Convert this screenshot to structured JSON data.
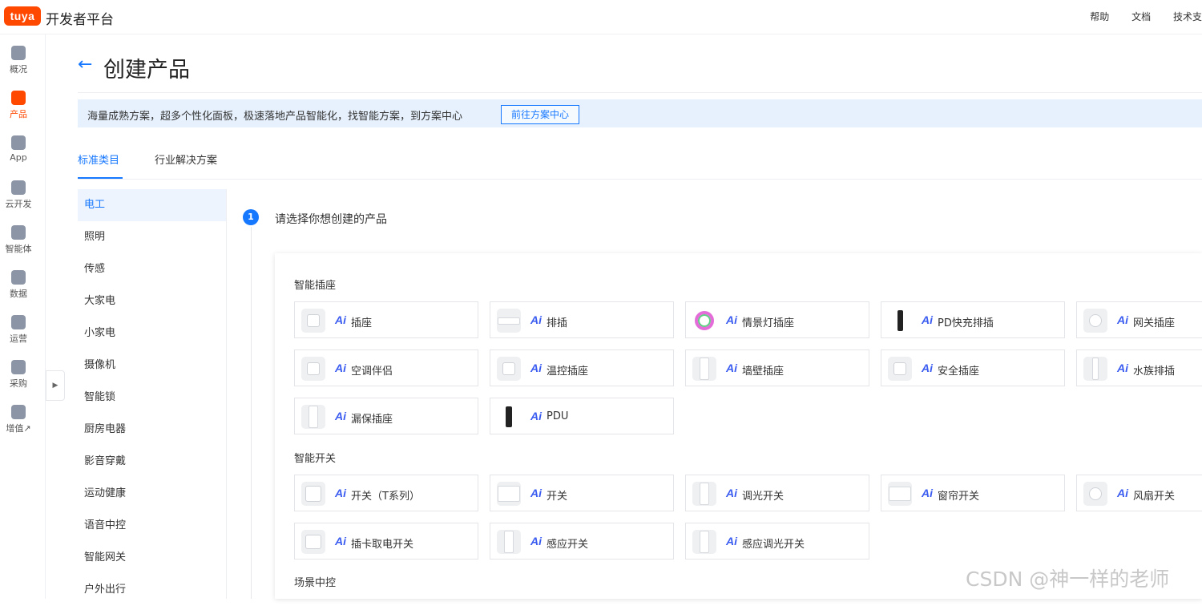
{
  "topbar": {
    "logo_text": "tuya",
    "brand": "开发者平台",
    "links": [
      "帮助",
      "文档",
      "技术支"
    ]
  },
  "leftnav": {
    "items": [
      {
        "label": "概况",
        "icon": "home-icon"
      },
      {
        "label": "产品",
        "icon": "terminal-icon",
        "active": true
      },
      {
        "label": "App",
        "icon": "phone-icon"
      },
      {
        "label": "云开发",
        "icon": "cloud-icon"
      },
      {
        "label": "智能体",
        "icon": "agent-icon"
      },
      {
        "label": "数据",
        "icon": "chart-icon"
      },
      {
        "label": "运营",
        "icon": "star-icon"
      },
      {
        "label": "采购",
        "icon": "box-icon"
      },
      {
        "label": "增值↗",
        "icon": "diamond-icon"
      }
    ],
    "collapse_glyph": "▶"
  },
  "header": {
    "back_glyph": "←",
    "title": "创建产品"
  },
  "banner": {
    "text": "海量成熟方案，超多个性化面板，极速落地产品智能化，找智能方案，到方案中心",
    "button": "前往方案中心"
  },
  "tabs": [
    {
      "label": "标准类目",
      "active": true
    },
    {
      "label": "行业解决方案"
    }
  ],
  "categories": [
    "电工",
    "照明",
    "传感",
    "大家电",
    "小家电",
    "摄像机",
    "智能锁",
    "厨房电器",
    "影音穿戴",
    "运动健康",
    "语音中控",
    "智能网关",
    "户外出行"
  ],
  "step": {
    "number": "1",
    "label": "请选择你想创建的产品"
  },
  "groups": [
    {
      "title": "智能插座",
      "items": [
        "插座",
        "排插",
        "情景灯插座",
        "PD快充排插",
        "网关插座",
        "空调伴侣",
        "温控插座",
        "墙壁插座",
        "安全插座",
        "水族排插",
        "漏保插座",
        "PDU"
      ]
    },
    {
      "title": "智能开关",
      "items": [
        "开关（T系列）",
        "开关",
        "调光开关",
        "窗帘开关",
        "风扇开关",
        "插卡取电开关",
        "感应开关",
        "感应调光开关"
      ]
    },
    {
      "title": "场景中控",
      "items": []
    }
  ],
  "ai_badge": "Ai",
  "watermark": "CSDN @神一样的老师"
}
